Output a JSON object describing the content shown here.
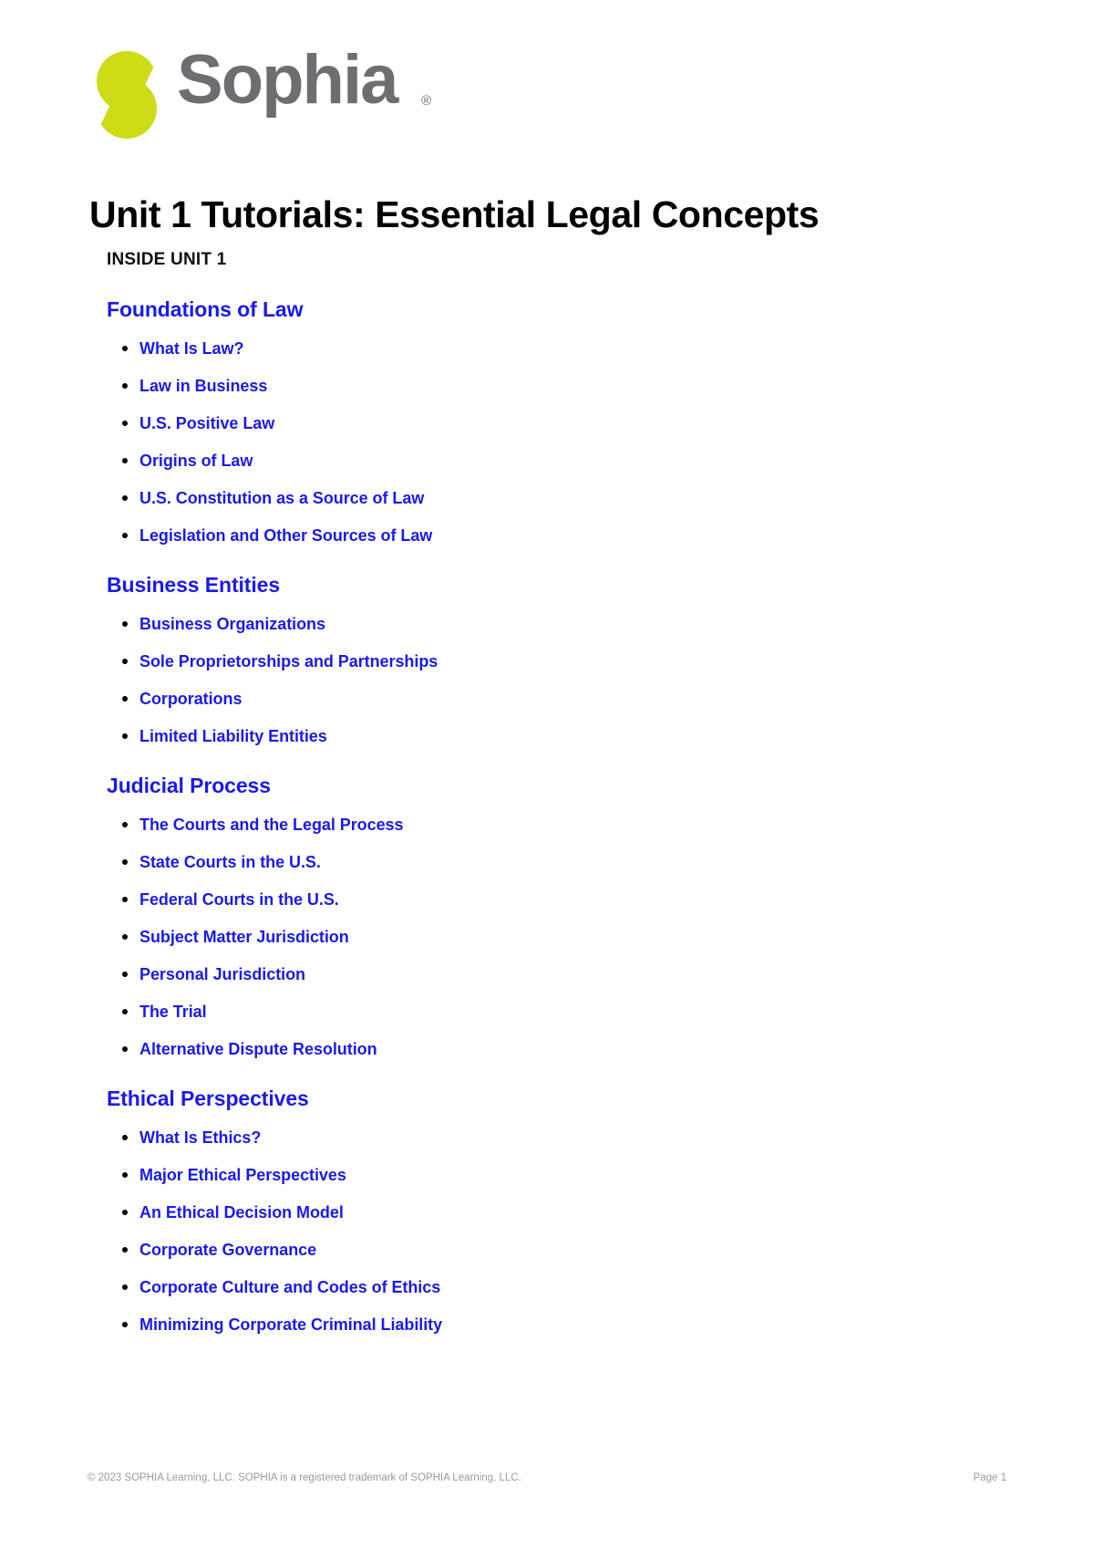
{
  "brand": {
    "name": "Sophia",
    "registered_mark": "®",
    "logo_mark_color": "#cddc17",
    "wordmark_color": "#6d6e71"
  },
  "document": {
    "title": "Unit 1 Tutorials: Essential Legal Concepts",
    "inside_label": "INSIDE UNIT 1",
    "link_color": "#1a1aeb"
  },
  "sections": [
    {
      "heading": "Foundations of Law",
      "items": [
        "What Is Law?",
        "Law in Business",
        "U.S. Positive Law",
        "Origins of Law",
        "U.S. Constitution as a Source of Law",
        "Legislation and Other Sources of Law"
      ]
    },
    {
      "heading": "Business Entities",
      "items": [
        "Business Organizations",
        "Sole Proprietorships and Partnerships",
        "Corporations",
        "Limited Liability Entities"
      ]
    },
    {
      "heading": "Judicial Process",
      "items": [
        "The Courts and the Legal Process",
        "State Courts in the U.S.",
        "Federal Courts in the U.S.",
        "Subject Matter Jurisdiction",
        "Personal Jurisdiction",
        "The Trial",
        "Alternative Dispute Resolution"
      ]
    },
    {
      "heading": "Ethical Perspectives",
      "items": [
        "What Is Ethics?",
        "Major Ethical Perspectives",
        "An Ethical Decision Model",
        "Corporate Governance",
        "Corporate Culture and Codes of Ethics",
        "Minimizing Corporate Criminal Liability"
      ]
    }
  ],
  "footer": {
    "copyright": "© 2023 SOPHIA Learning, LLC. SOPHIA is a registered trademark of SOPHIA Learning, LLC.",
    "page_label": "Page 1"
  }
}
